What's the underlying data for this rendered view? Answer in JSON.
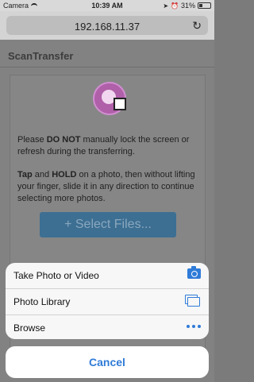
{
  "status_bar": {
    "carrier": "Camera",
    "signal": "••ll",
    "wifi": "wifi-icon",
    "time": "10:39 AM",
    "location": "location-icon",
    "alarm": "alarm-icon",
    "battery_percent": "31%"
  },
  "url_bar": {
    "url": "192.168.11.37",
    "reload_icon": "↻"
  },
  "page": {
    "title": "ScanTransfer",
    "para1_prefix": "Please ",
    "para1_bold": "DO NOT",
    "para1_suffix": " manually lock the screen or refresh during the transferring.",
    "para2_bold1": "Tap",
    "para2_mid1": " and ",
    "para2_bold2": "HOLD",
    "para2_suffix": " on a photo, then without lifting your finger, slide it in any direction to continue selecting more photos.",
    "select_button": "+ Select Files..."
  },
  "action_sheet": {
    "items": [
      {
        "label": "Take Photo or Video",
        "icon": "camera-icon"
      },
      {
        "label": "Photo Library",
        "icon": "photo-library-icon"
      },
      {
        "label": "Browse",
        "icon": "more-icon"
      }
    ],
    "cancel_label": "Cancel"
  },
  "colors": {
    "accent": "#2f7bd8",
    "select_button_bg": "#3d6f93",
    "logo": "#b05fa9"
  }
}
